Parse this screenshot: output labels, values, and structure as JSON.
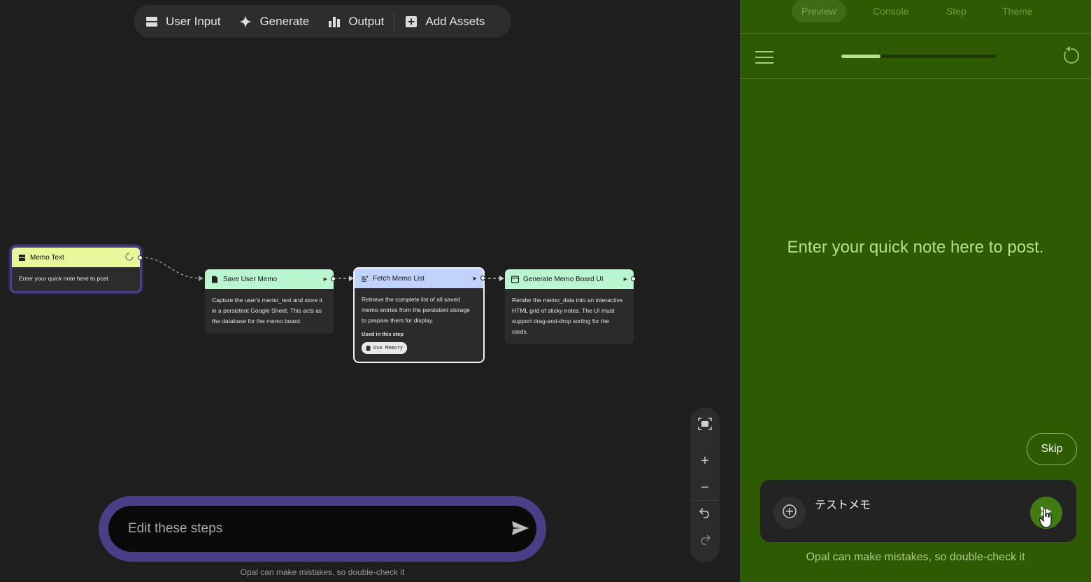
{
  "toolbar": {
    "items": [
      {
        "label": "User Input",
        "icon": "user-input-icon"
      },
      {
        "label": "Generate",
        "icon": "sparkle-icon"
      },
      {
        "label": "Output",
        "icon": "output-icon"
      },
      {
        "label": "Add Assets",
        "icon": "add-box-icon"
      }
    ]
  },
  "nodes": {
    "memo_text": {
      "title": "Memo Text",
      "body": "Enter your quick note here to post.",
      "color": "#e6f79c",
      "status_icon": "loading-spinner-icon"
    },
    "save": {
      "title": "Save User Memo",
      "body": "Capture the user's memo_text and store it in a persistent Google Sheet. This acts as the database for the memo board.",
      "color": "#b9f5cf"
    },
    "fetch": {
      "title": "Fetch Memo List",
      "body": "Retrieve the complete list of all saved memo entries from the persistent storage to prepare them for display.",
      "used_label": "Used in this step",
      "chip": "Use Memory",
      "color": "#c2d3fb"
    },
    "generate": {
      "title": "Generate Memo Board UI",
      "body": "Render the memo_data into an interactive HTML grid of sticky notes. The UI must support drag-and-drop sorting for the cards.",
      "color": "#b9f5cf"
    }
  },
  "zoom_controls": [
    "fit-view-icon",
    "zoom-in-icon",
    "zoom-out-icon",
    "undo-icon",
    "redo-icon"
  ],
  "prompt": {
    "placeholder": "Edit these steps",
    "disclaimer": "Opal can make mistakes, so double-check it"
  },
  "panel": {
    "tabs": [
      {
        "label": "Preview",
        "active": true
      },
      {
        "label": "Console",
        "active": false
      },
      {
        "label": "Step",
        "active": false
      },
      {
        "label": "Theme",
        "active": false
      }
    ],
    "progress": 0.25,
    "question": "Enter your quick note here to post.",
    "skip_label": "Skip",
    "chat_value": "テストメモ",
    "disclaimer": "Opal can make mistakes, so double-check it"
  }
}
